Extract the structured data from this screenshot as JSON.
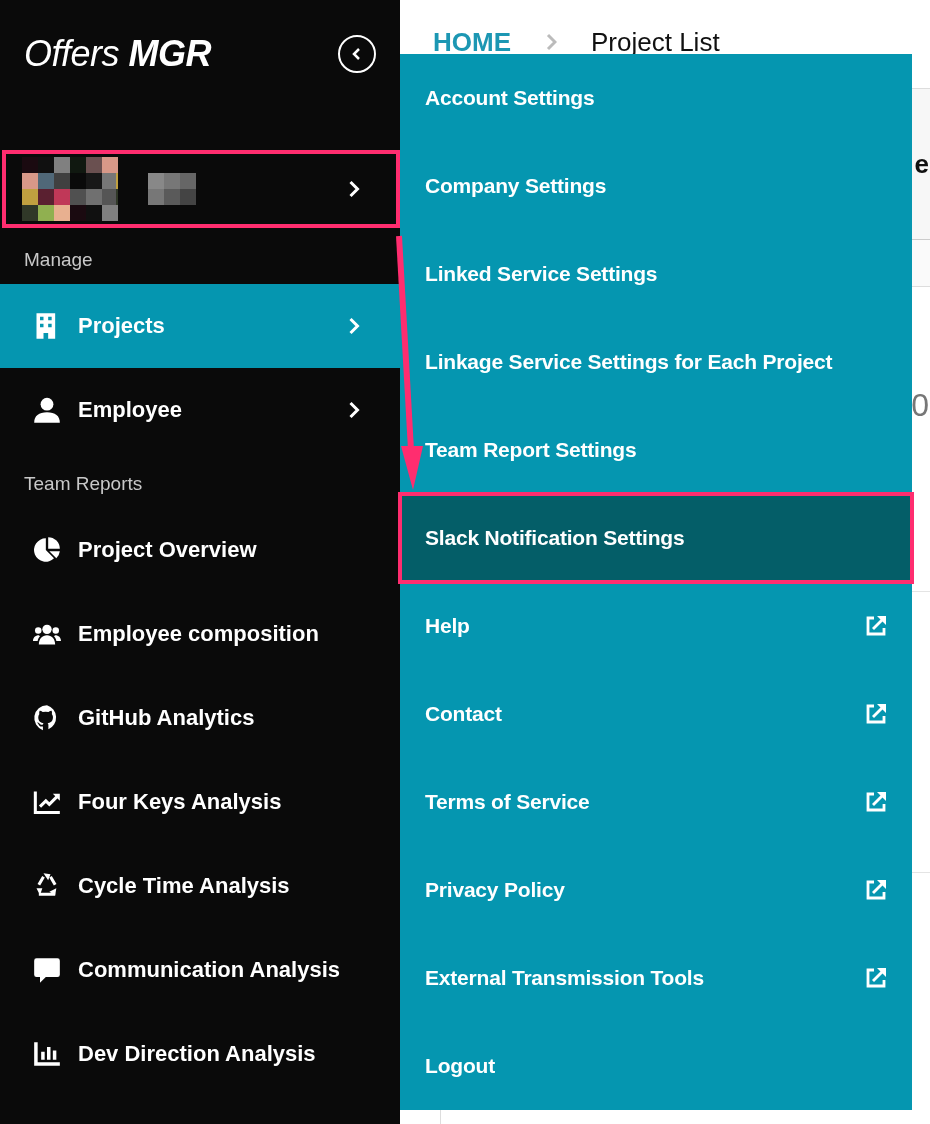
{
  "sidebar": {
    "logo": "Offers **MGR**",
    "user": {
      "annotated": true
    },
    "sections": [
      {
        "label": "Manage",
        "items": [
          {
            "label": "Projects",
            "selected": true,
            "has_submenu": true
          },
          {
            "label": "Employee",
            "selected": false,
            "has_submenu": true
          }
        ]
      },
      {
        "label": "Team Reports",
        "items": [
          {
            "label": "Project Overview",
            "selected": false,
            "has_submenu": false
          },
          {
            "label": "Employee composition",
            "selected": false,
            "has_submenu": false
          },
          {
            "label": "GitHub Analytics",
            "selected": false,
            "has_submenu": false
          },
          {
            "label": "Four Keys Analysis",
            "selected": false,
            "has_submenu": false
          },
          {
            "label": "Cycle Time Analysis",
            "selected": false,
            "has_submenu": false
          },
          {
            "label": "Communication Analysis",
            "selected": false,
            "has_submenu": false
          },
          {
            "label": "Dev Direction Analysis",
            "selected": false,
            "has_submenu": false
          }
        ]
      }
    ]
  },
  "breadcrumb": [
    {
      "label": "HOME",
      "kind": "link"
    },
    {
      "label": "Project List",
      "kind": "current"
    }
  ],
  "content": {
    "header_fragment": "e",
    "value_fragment": "0"
  },
  "settings_menu": {
    "items": [
      {
        "label": "Account Settings",
        "external": false,
        "selected": false,
        "annotated": false
      },
      {
        "label": "Company Settings",
        "external": false,
        "selected": false,
        "annotated": false
      },
      {
        "label": "Linked Service Settings",
        "external": false,
        "selected": false,
        "annotated": false
      },
      {
        "label": "Linkage Service Settings for Each Project",
        "external": false,
        "selected": false,
        "annotated": false
      },
      {
        "label": "Team Report Settings",
        "external": false,
        "selected": false,
        "annotated": false
      },
      {
        "label": "Slack Notification Settings",
        "external": false,
        "selected": true,
        "annotated": true
      },
      {
        "label": "Help",
        "external": true,
        "selected": false,
        "annotated": false
      },
      {
        "label": "Contact",
        "external": true,
        "selected": false,
        "annotated": false
      },
      {
        "label": "Terms of Service",
        "external": true,
        "selected": false,
        "annotated": false
      },
      {
        "label": "Privacy Policy",
        "external": true,
        "selected": false,
        "annotated": false
      },
      {
        "label": "External Transmission Tools",
        "external": true,
        "selected": false,
        "annotated": false
      },
      {
        "label": "Logout",
        "external": false,
        "selected": false,
        "annotated": false
      }
    ]
  }
}
